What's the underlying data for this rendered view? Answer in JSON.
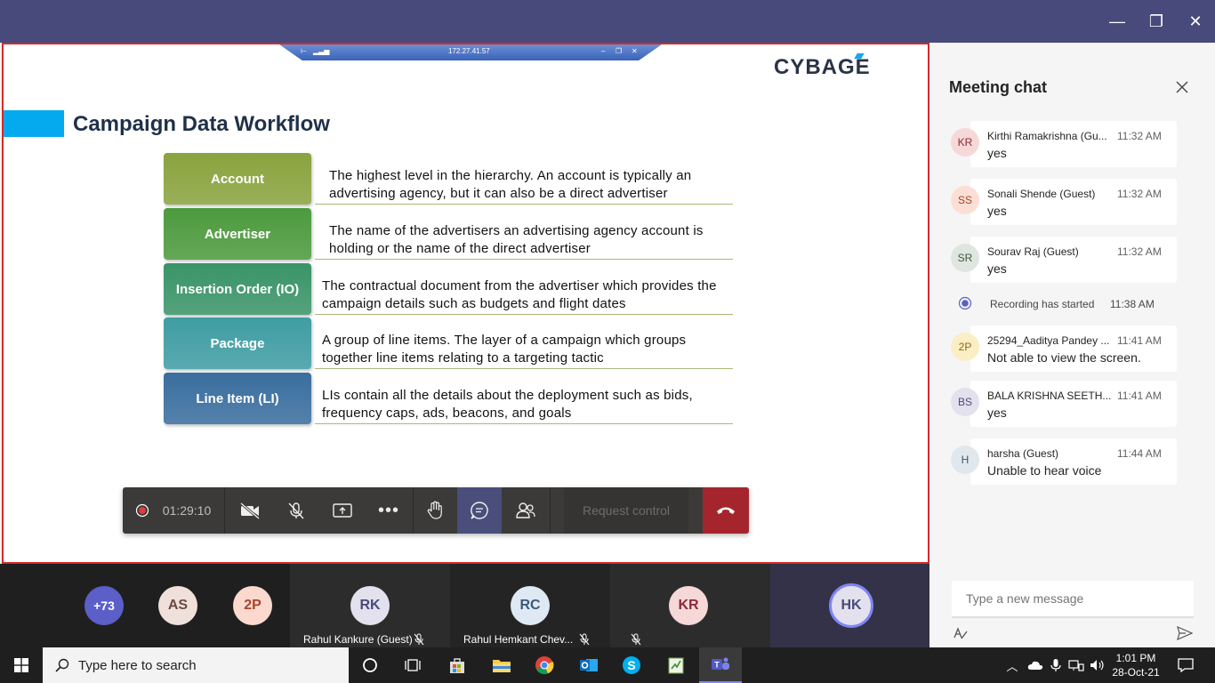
{
  "window": {
    "minimize": "—",
    "restore": "❐",
    "close": "✕"
  },
  "rdp": {
    "ip": "172.27.41.57"
  },
  "slide": {
    "logo": "CYBAGE",
    "title": "Campaign Data Workflow",
    "rows": [
      {
        "label": "Account",
        "desc": "The highest level in the hierarchy. An account is typically an advertising agency, but it can also be a direct advertiser",
        "color": "#8aa33e"
      },
      {
        "label": "Advertiser",
        "desc": "The name of the advertisers an advertising agency account is holding or the name of the direct advertiser",
        "color": "#4d9a3e"
      },
      {
        "label": "Insertion Order (IO)",
        "desc": "The contractual document from the advertiser which provides the campaign details such as budgets and flight dates",
        "color": "#3a9468"
      },
      {
        "label": "Package",
        "desc": "A group of line items. The layer of a campaign which groups together line items relating to a targeting tactic",
        "color": "#3f9da3"
      },
      {
        "label": "Line Item (LI)",
        "desc": "LIs contain all the details about the deployment such as bids, frequency caps, ads, beacons, and goals",
        "color": "#3a6e9e"
      }
    ]
  },
  "controls": {
    "timer": "01:29:10",
    "request_control": "Request control"
  },
  "chat": {
    "title": "Meeting chat",
    "messages": [
      {
        "initials": "KR",
        "name": "Kirthi Ramakrishna (Gu...",
        "time": "11:32 AM",
        "text": "yes",
        "bg": "#f6d8d8",
        "fg": "#8a2a3a"
      },
      {
        "initials": "SS",
        "name": "Sonali Shende (Guest)",
        "time": "11:32 AM",
        "text": "yes",
        "bg": "#fbdfd5",
        "fg": "#a5452a"
      },
      {
        "initials": "SR",
        "name": "Sourav Raj (Guest)",
        "time": "11:32 AM",
        "text": "yes",
        "bg": "#dfe6df",
        "fg": "#3d5a3d"
      },
      {
        "initials": "2P",
        "name": "25294_Aaditya Pandey ...",
        "time": "11:41 AM",
        "text": "Not able to view the screen.",
        "bg": "#fbeec4",
        "fg": "#8a6a10"
      },
      {
        "initials": "BS",
        "name": "BALA KRISHNA SEETH...",
        "time": "11:41 AM",
        "text": "yes",
        "bg": "#e3e1ee",
        "fg": "#4b4a7a"
      },
      {
        "initials": "H",
        "name": "harsha (Guest)",
        "time": "11:44 AM",
        "text": "Unable to hear voice",
        "bg": "#e0e8ee",
        "fg": "#3d5566"
      }
    ],
    "recording": {
      "text": "Recording has started",
      "time": "11:38 AM"
    },
    "compose_placeholder": "Type a new message"
  },
  "participants": {
    "overflow": "+73",
    "small": [
      {
        "initials": "AS"
      },
      {
        "initials": "2P"
      }
    ],
    "tiles": [
      {
        "initials": "RK",
        "name": "Rahul Kankure (Guest)"
      },
      {
        "initials": "RC",
        "name": "Rahul Hemkant Chev..."
      },
      {
        "initials": "KR",
        "name": ""
      }
    ],
    "self": "HK"
  },
  "taskbar": {
    "search_placeholder": "Type here to search",
    "time": "1:01 PM",
    "date": "28-Oct-21"
  }
}
